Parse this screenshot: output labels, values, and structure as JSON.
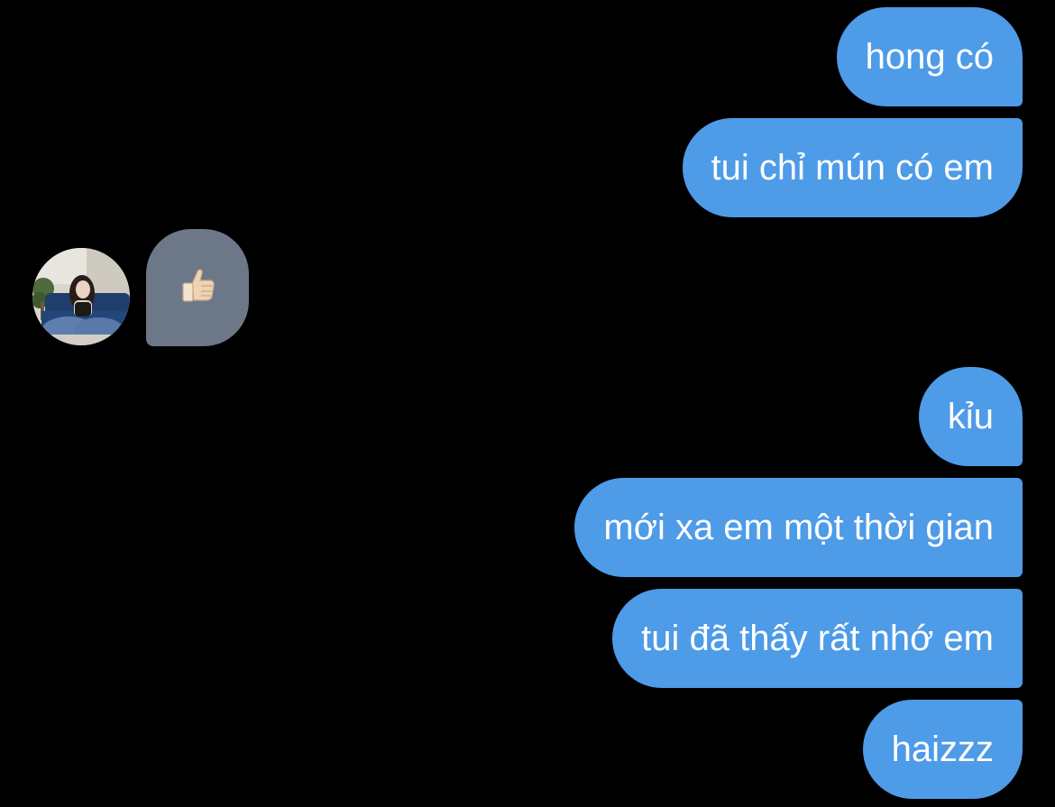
{
  "chat": {
    "messages": [
      {
        "text": "hong có",
        "sender": "me"
      },
      {
        "text": "tui chỉ mún có em",
        "sender": "me"
      },
      {
        "icon": "thumbs-up-icon",
        "sender": "other"
      },
      {
        "text": "kỉu",
        "sender": "me"
      },
      {
        "text": "mới xa em một thời gian",
        "sender": "me"
      },
      {
        "text": "tui đã thấy rất nhớ em",
        "sender": "me"
      },
      {
        "text": "haizzz",
        "sender": "me"
      }
    ]
  },
  "colors": {
    "background": "#000000",
    "outgoing_bubble": "#4e9be8",
    "incoming_bubble": "#6c7888",
    "text": "#ffffff"
  }
}
